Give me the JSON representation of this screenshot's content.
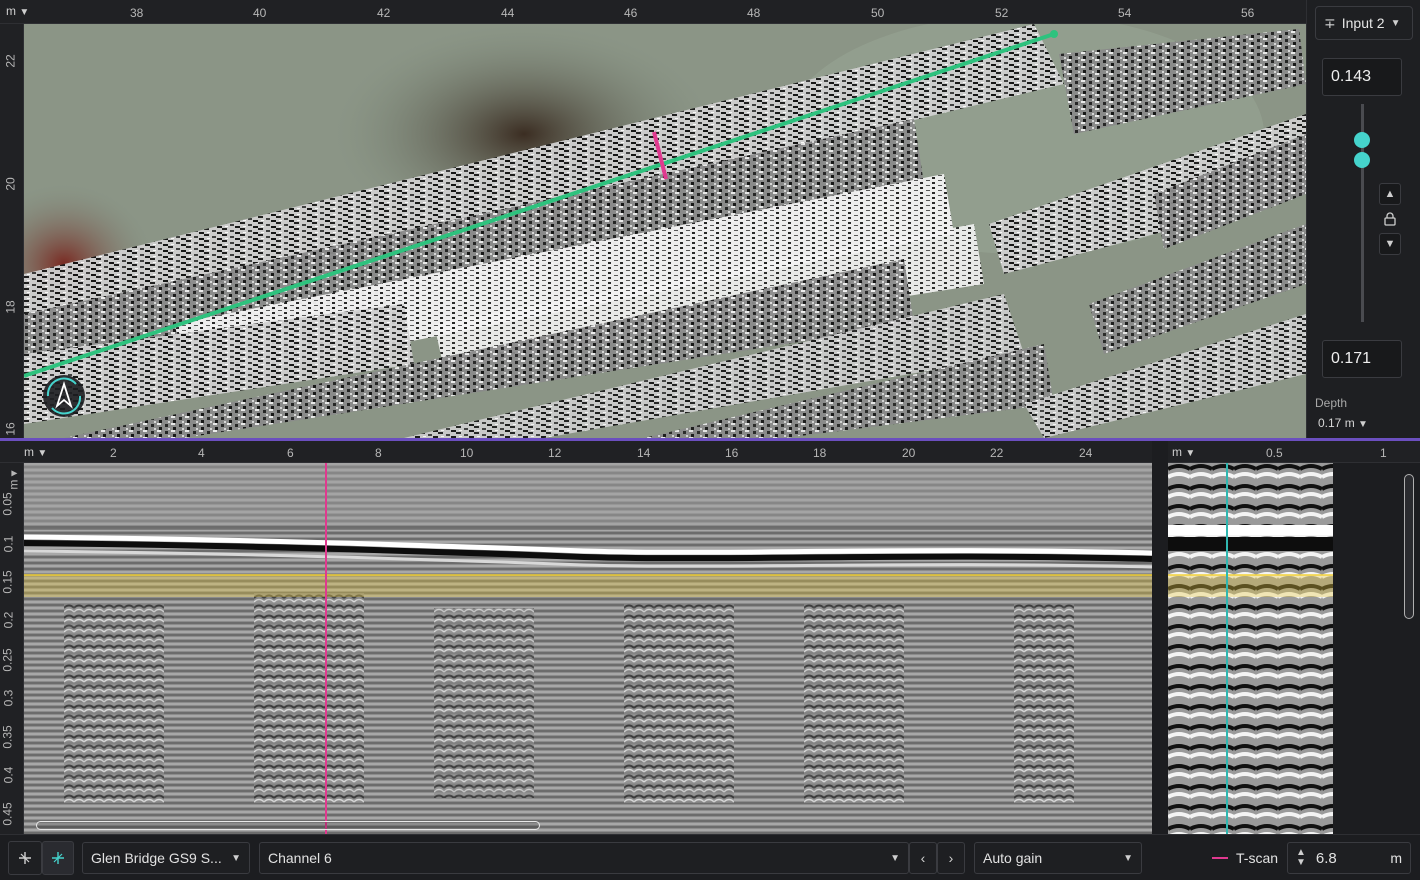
{
  "map": {
    "unit": "m",
    "x_ticks": [
      "38",
      "40",
      "42",
      "44",
      "46",
      "48",
      "50",
      "52",
      "54",
      "56"
    ],
    "y_ticks": [
      "22",
      "20",
      "18",
      "16"
    ]
  },
  "depth_panel": {
    "input_label": "Input 2",
    "upper_value": "0.143",
    "lower_value": "0.171",
    "depth_label": "Depth",
    "depth_value": "0.17 m"
  },
  "bscan": {
    "unit": "m",
    "x_ticks": [
      "2",
      "4",
      "6",
      "8",
      "10",
      "12",
      "14",
      "16",
      "18",
      "20",
      "22",
      "24"
    ],
    "y_unit": "m",
    "y_ticks": [
      "0.05",
      "0.1",
      "0.15",
      "0.2",
      "0.25",
      "0.3",
      "0.35",
      "0.4",
      "0.45"
    ]
  },
  "tscan": {
    "unit": "m",
    "x_ticks": [
      "0.5",
      "1"
    ]
  },
  "toolbar": {
    "project": "Glen Bridge GS9 S...",
    "channel": "Channel 6",
    "gain": "Auto gain",
    "tscan_label": "T-scan",
    "position_value": "6.8",
    "position_unit": "m"
  },
  "colors": {
    "accent": "#45d3cc",
    "survey_line": "#2ec27e",
    "cursor": "#e0398f",
    "depth_band": "#e8c840",
    "divider": "#6b4fbf"
  },
  "icons": [
    "chevron-down-icon",
    "input-icon",
    "lock-icon",
    "chevron-up-icon",
    "compass-icon",
    "cursor-tool-icon",
    "pan-tool-icon",
    "chevron-left-icon",
    "chevron-right-icon",
    "stepper-icon"
  ]
}
